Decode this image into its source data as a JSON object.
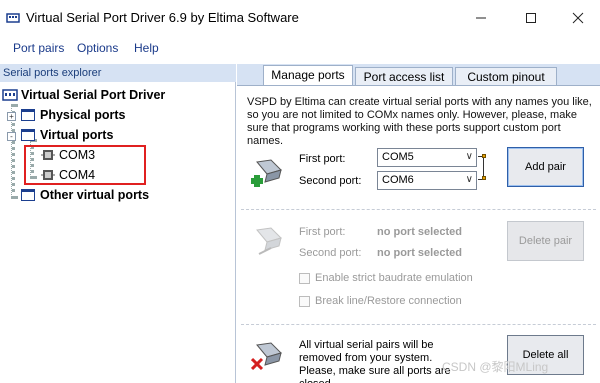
{
  "window": {
    "title": "Virtual Serial Port Driver 6.9 by Eltima Software",
    "icon": "vspd-app-icon",
    "controls": {
      "minimize_icon": "minimize-icon",
      "maximize_icon": "maximize-icon",
      "close_icon": "close-icon"
    }
  },
  "menu": {
    "items": [
      "Port pairs",
      "Options",
      "Help"
    ]
  },
  "explorer": {
    "header": "Serial ports explorer",
    "root": "Virtual Serial Port Driver",
    "nodes": [
      {
        "label": "Physical ports",
        "expander": "+"
      },
      {
        "label": "Virtual ports",
        "expander": "-"
      },
      {
        "label": "COM3"
      },
      {
        "label": "COM4"
      },
      {
        "label": "Other virtual ports"
      }
    ]
  },
  "tabs": [
    "Manage ports",
    "Port access list",
    "Custom pinout"
  ],
  "active_tab": "Manage ports",
  "manage": {
    "description": "VSPD by Eltima can create virtual serial ports with any names you like, so you are not limited to COMx names only. However, please, make sure that programs working with these ports support custom port names.",
    "add": {
      "first_label": "First port:",
      "second_label": "Second port:",
      "first_value": "COM5",
      "second_value": "COM6",
      "button": "Add pair"
    },
    "delete": {
      "first_label": "First port:",
      "second_label": "Second port:",
      "first_value": "no port selected",
      "second_value": "no port selected",
      "button": "Delete pair",
      "check_baudrate": "Enable strict baudrate emulation",
      "check_break": "Break line/Restore connection"
    },
    "delete_all": {
      "text": "All virtual serial pairs will be removed from your system. Please, make sure all ports are closed.",
      "button": "Delete all"
    }
  },
  "watermark": "CSDN @黎阳MLing",
  "colors": {
    "accent": "#1c3f8f",
    "explorer_header_bg": "#d6e2f3",
    "highlight": "#e02020",
    "plug_green": "#2a9d3a",
    "plug_red": "#d42020"
  }
}
